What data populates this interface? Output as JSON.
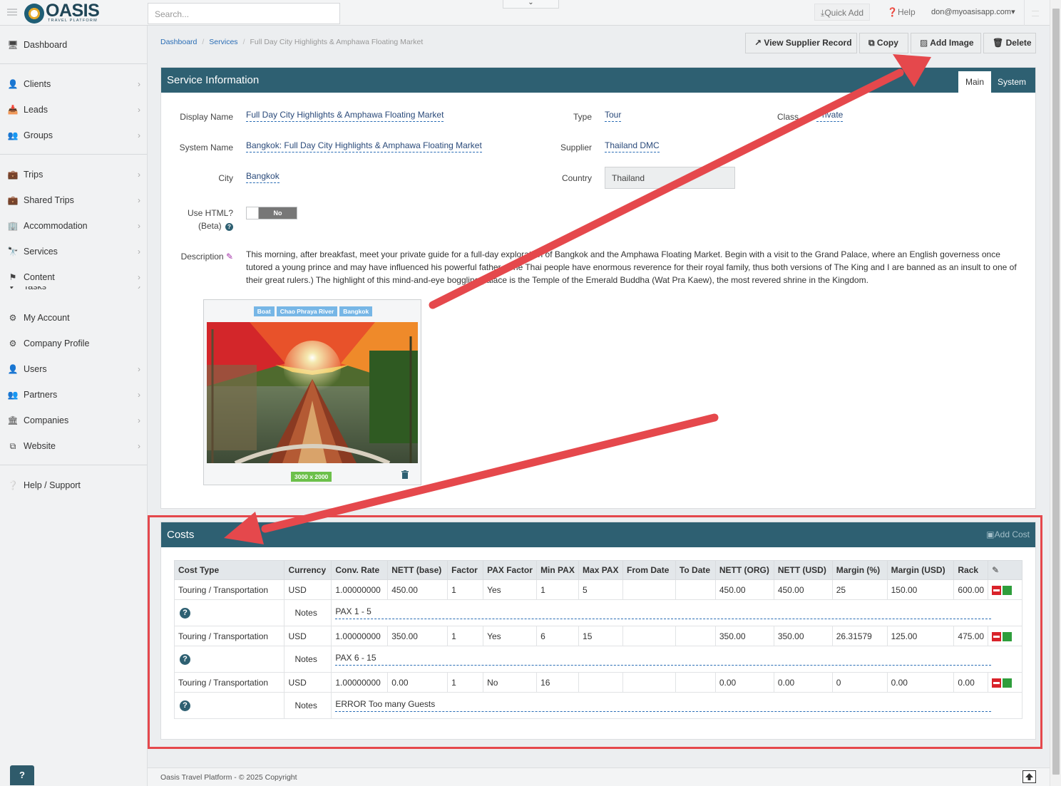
{
  "app": {
    "logo_text": "OASIS",
    "logo_sub": "TRAVEL PLATFORM",
    "search_placeholder": "Search...",
    "quick_add": "Quick Add",
    "help": "Help",
    "user": "don@myoasisapp.com"
  },
  "sidebar": {
    "items": [
      {
        "label": "Dashboard",
        "icon": "monitor-icon"
      },
      {
        "label": "Clients",
        "icon": "user-icon"
      },
      {
        "label": "Leads",
        "icon": "inbox-icon"
      },
      {
        "label": "Groups",
        "icon": "users-icon"
      },
      {
        "label": "Trips",
        "icon": "briefcase-icon"
      },
      {
        "label": "Shared Trips",
        "icon": "briefcase-icon"
      },
      {
        "label": "Accommodation",
        "icon": "building-icon"
      },
      {
        "label": "Services",
        "icon": "binoculars-icon"
      },
      {
        "label": "Content",
        "icon": "flag-icon"
      },
      {
        "label": "Tasks",
        "icon": "check-icon"
      },
      {
        "label": "My Account",
        "icon": "gear-icon"
      },
      {
        "label": "Company Profile",
        "icon": "gears-icon"
      },
      {
        "label": "Users",
        "icon": "user-icon"
      },
      {
        "label": "Partners",
        "icon": "users-icon"
      },
      {
        "label": "Companies",
        "icon": "bank-icon"
      },
      {
        "label": "Website",
        "icon": "sitemap-icon"
      },
      {
        "label": "Help / Support",
        "icon": "question-circle-icon"
      }
    ],
    "help_bubble": "?"
  },
  "breadcrumb": {
    "dashboard": "Dashboard",
    "services": "Services",
    "current": "Full Day City Highlights & Amphawa Floating Market"
  },
  "header_buttons": {
    "view_supplier": "View Supplier Record",
    "copy": "Copy",
    "add_image": "Add Image",
    "delete": "Delete"
  },
  "service": {
    "title": "Service Information",
    "tab_main": "Main",
    "tab_system": "System",
    "display_name_label": "Display Name",
    "display_name": "Full Day City Highlights & Amphawa Floating Market",
    "system_name_label": "System Name",
    "system_name": "Bangkok: Full Day City Highlights & Amphawa Floating Market",
    "city_label": "City",
    "city": "Bangkok",
    "type_label": "Type",
    "type": "Tour",
    "supplier_label": "Supplier",
    "supplier": "Thailand DMC",
    "country_label": "Country",
    "country": "Thailand",
    "class_label": "Class",
    "class": "Private",
    "use_html_label": "Use HTML?",
    "use_html_sub": "(Beta)",
    "use_html_value": "No",
    "description_label": "Description",
    "description": "This morning, after breakfast, meet your private guide for a full-day exploration of Bangkok and the Amphawa Floating Market. Begin with a visit to the Grand Palace, where an English governess once tutored a young prince and may have influenced his powerful father. (The Thai people have enormous reverence for their royal family, thus both versions of The King and I are banned as an insult to one of their great rulers.) The highlight of this mind-and-eye boggling palace is the Temple of the Emerald Buddha (Wat Pra Kaew), the most revered shrine in the Kingdom.",
    "image_tags": [
      "Boat",
      "Chao Phraya River",
      "Bangkok"
    ],
    "image_size": "3000 x 2000"
  },
  "costs": {
    "title": "Costs",
    "add_cost": "Add Cost",
    "columns": [
      "Cost Type",
      "Currency",
      "Conv. Rate",
      "NETT (base)",
      "Factor",
      "PAX Factor",
      "Min PAX",
      "Max PAX",
      "From Date",
      "To Date",
      "NETT (ORG)",
      "NETT (USD)",
      "Margin (%)",
      "Margin (USD)",
      "Rack"
    ],
    "notes_label": "Notes",
    "rows": [
      {
        "cells": [
          "Touring / Transportation",
          "USD",
          "1.00000000",
          "450.00",
          "1",
          "Yes",
          "1",
          "5",
          "",
          "",
          "450.00",
          "450.00",
          "25",
          "150.00",
          "600.00"
        ],
        "notes": "PAX 1 - 5"
      },
      {
        "cells": [
          "Touring / Transportation",
          "USD",
          "1.00000000",
          "350.00",
          "1",
          "Yes",
          "6",
          "15",
          "",
          "",
          "350.00",
          "350.00",
          "26.31579",
          "125.00",
          "475.00"
        ],
        "notes": "PAX 6 - 15"
      },
      {
        "cells": [
          "Touring / Transportation",
          "USD",
          "1.00000000",
          "0.00",
          "1",
          "No",
          "16",
          "",
          "",
          "",
          "0.00",
          "0.00",
          "0",
          "0.00",
          "0.00"
        ],
        "notes": "ERROR Too many Guests"
      }
    ]
  },
  "footer": {
    "text": "Oasis Travel Platform - © 2025 Copyright"
  },
  "colors": {
    "header_teal": "#2e6072",
    "annotation_red": "#e5484c",
    "link_blue": "#2a6db5"
  }
}
